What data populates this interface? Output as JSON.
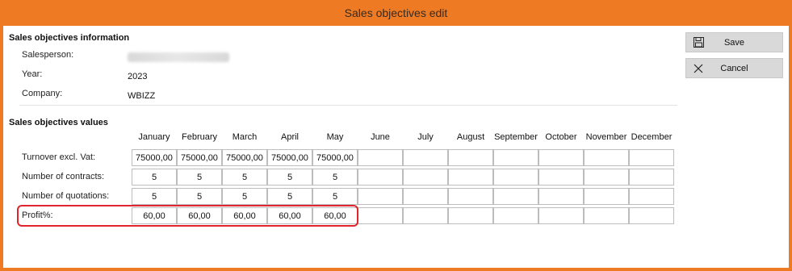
{
  "window": {
    "title": "Sales objectives edit"
  },
  "info": {
    "heading": "Sales objectives information",
    "salesperson_label": "Salesperson:",
    "year_label": "Year:",
    "year_value": "2023",
    "company_label": "Company:",
    "company_value": "WBIZZ"
  },
  "values": {
    "heading": "Sales objectives values",
    "months": [
      "January",
      "February",
      "March",
      "April",
      "May",
      "June",
      "July",
      "August",
      "September",
      "October",
      "November",
      "December"
    ],
    "rows": [
      {
        "label": "Turnover excl. Vat:",
        "cells": [
          "75000,00",
          "75000,00",
          "75000,00",
          "75000,00",
          "75000,00",
          "",
          "",
          "",
          "",
          "",
          "",
          ""
        ]
      },
      {
        "label": "Number of contracts:",
        "cells": [
          "5",
          "5",
          "5",
          "5",
          "5",
          "",
          "",
          "",
          "",
          "",
          "",
          ""
        ]
      },
      {
        "label": "Number of quotations:",
        "cells": [
          "5",
          "5",
          "5",
          "5",
          "5",
          "",
          "",
          "",
          "",
          "",
          "",
          ""
        ]
      },
      {
        "label": "Profit%:",
        "cells": [
          "60,00",
          "60,00",
          "60,00",
          "60,00",
          "60,00",
          "",
          "",
          "",
          "",
          "",
          "",
          ""
        ]
      }
    ]
  },
  "actions": {
    "save_label": "Save",
    "cancel_label": "Cancel",
    "save_icon": "floppy-disk-icon",
    "cancel_icon": "close-icon"
  },
  "colors": {
    "window_frame": "#ee7a23",
    "highlight": "#e0262c"
  }
}
